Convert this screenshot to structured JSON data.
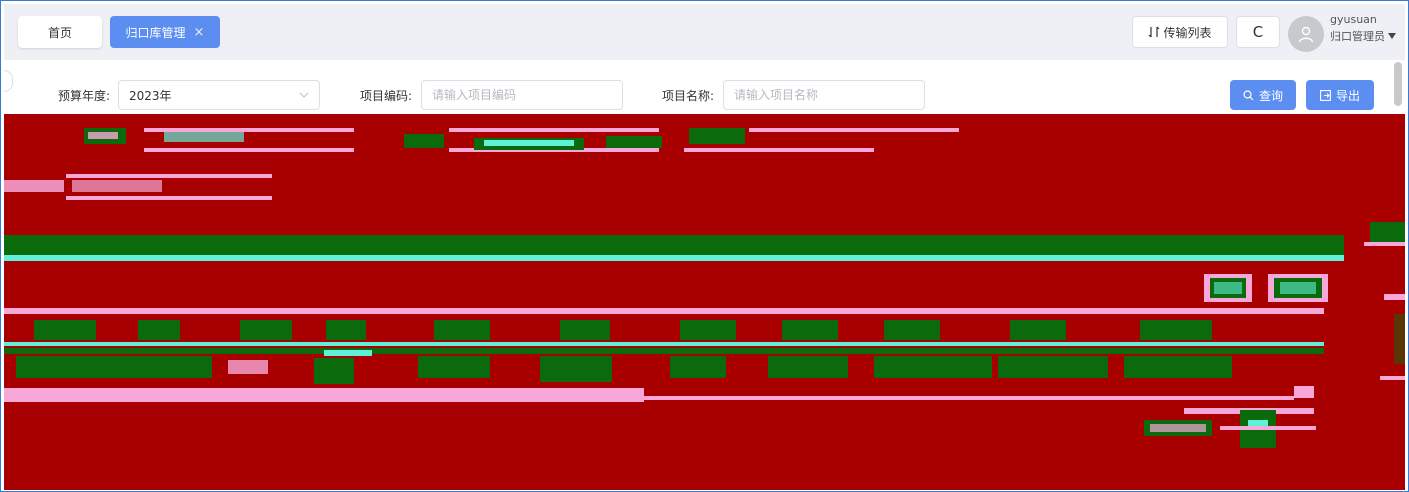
{
  "tabs": {
    "home_label": "首页",
    "active_label": "归口库管理",
    "close_glyph": "×"
  },
  "header": {
    "transfer_label": "传输列表",
    "refresh_glyph": "C",
    "user_name": "gyusuan",
    "user_role": "归口管理员"
  },
  "search": {
    "year_label": "预算年度:",
    "year_value": "2023年",
    "code_label": "项目编码:",
    "code_placeholder": "请输入项目编码",
    "name_label": "项目名称:",
    "name_placeholder": "请输入项目名称",
    "query_label": "查询",
    "export_label": "导出"
  },
  "colors": {
    "accent": "#5b8ef0",
    "corrupt_bg": "#a80000",
    "corrupt_green": "#0b6a0b",
    "corrupt_pink": "#f7a8d8",
    "corrupt_cyan": "#5ff0d8"
  },
  "icons": [
    "close-icon",
    "transfer-icon",
    "refresh-icon",
    "user-icon",
    "chevron-down-icon",
    "search-icon",
    "export-icon"
  ]
}
